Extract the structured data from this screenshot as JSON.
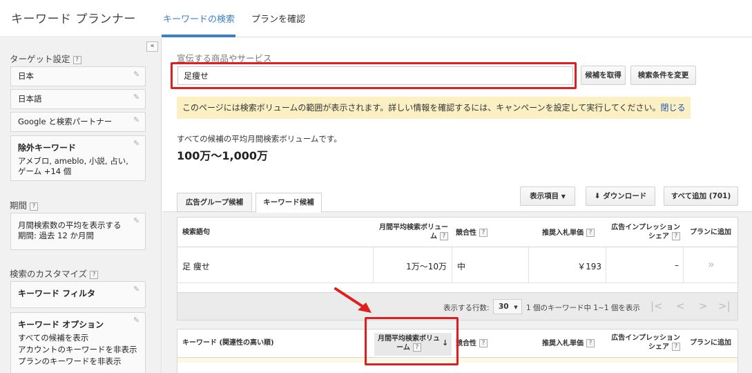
{
  "header": {
    "app_title": "キーワード プランナー",
    "tabs": [
      {
        "label": "キーワードの検索",
        "active": true
      },
      {
        "label": "プランを確認",
        "active": false
      }
    ]
  },
  "sidebar": {
    "collapse_label": "«",
    "targeting": {
      "heading": "ターゲット設定",
      "help": "?",
      "location": "日本",
      "language": "日本語",
      "network": "Google と検索パートナー",
      "negative_title": "除外キーワード",
      "negative_text": "アメブロ, ameblo, 小説, 占い, ゲーム +14 個"
    },
    "period": {
      "heading": "期間",
      "help": "?",
      "text1": "月間検索数の平均を表示する",
      "text2": "期間: 過去 12 か月間"
    },
    "customize": {
      "heading": "検索のカスタマイズ",
      "help": "?",
      "filter_title": "キーワード フィルタ",
      "options_title": "キーワード オプション",
      "options": [
        "すべての候補を表示",
        "アカウントのキーワードを非表示",
        "プランのキーワードを非表示"
      ]
    }
  },
  "main": {
    "product_label": "宣伝する商品やサービス",
    "keyword_value": "足痩せ",
    "get_ideas_button": "候補を取得",
    "modify_search_button": "検索条件を変更",
    "notice_text": "このページには検索ボリュームの範囲が表示されます。詳しい情報を確認するには、キャンペーンを設定して実行してください。",
    "notice_close": "閉じる",
    "avg_label": "すべての候補の平均月間検索ボリュームです。",
    "avg_value": "100万～1,000万",
    "tabs": [
      {
        "label": "広告グループ候補",
        "active": false
      },
      {
        "label": "キーワード候補",
        "active": true
      }
    ],
    "columns_button": "表示項目",
    "download_button": "ダウンロード",
    "add_all_button": "すべて追加 (701)",
    "search_table": {
      "headers": {
        "term": "検索語句",
        "volume": "月間平均検索ボリューム",
        "competition": "競合性",
        "bid": "推奨入札単価",
        "impr": "広告インプレッションシェア",
        "add": "プランに追加"
      },
      "row": {
        "term": "足 痩せ",
        "volume": "1万～10万",
        "competition": "中",
        "bid": "￥193",
        "impr": "–",
        "add": "»"
      }
    },
    "pager": {
      "rows_label": "表示する行数:",
      "rows_value": "30",
      "summary": "1 個のキーワード中 1~1 個を表示"
    },
    "ideas_table": {
      "headers": {
        "keyword": "キーワード (関連性の高い順)",
        "volume": "月間平均検索ボリューム",
        "competition": "競合性",
        "bid": "推奨入札単価",
        "impr": "広告インプレッションシェア",
        "add": "プランに追加"
      }
    }
  },
  "colors": {
    "accent": "#3d7ec6",
    "highlight": "#e01e1e",
    "notice_bg": "#faf0c4"
  }
}
